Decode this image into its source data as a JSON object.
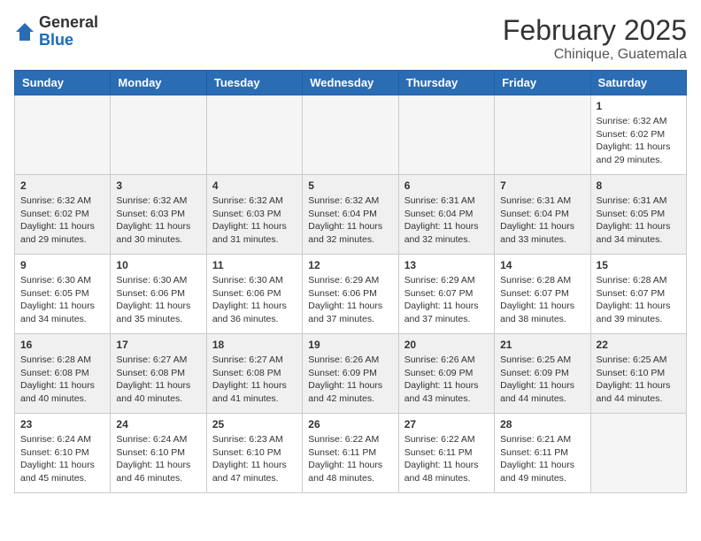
{
  "header": {
    "logo": {
      "general": "General",
      "blue": "Blue"
    },
    "title": "February 2025",
    "location": "Chinique, Guatemala"
  },
  "days_of_week": [
    "Sunday",
    "Monday",
    "Tuesday",
    "Wednesday",
    "Thursday",
    "Friday",
    "Saturday"
  ],
  "weeks": [
    {
      "bg": "white",
      "days": [
        {
          "num": "",
          "info": ""
        },
        {
          "num": "",
          "info": ""
        },
        {
          "num": "",
          "info": ""
        },
        {
          "num": "",
          "info": ""
        },
        {
          "num": "",
          "info": ""
        },
        {
          "num": "",
          "info": ""
        },
        {
          "num": "1",
          "info": "Sunrise: 6:32 AM\nSunset: 6:02 PM\nDaylight: 11 hours and 29 minutes."
        }
      ]
    },
    {
      "bg": "gray",
      "days": [
        {
          "num": "2",
          "info": "Sunrise: 6:32 AM\nSunset: 6:02 PM\nDaylight: 11 hours and 29 minutes."
        },
        {
          "num": "3",
          "info": "Sunrise: 6:32 AM\nSunset: 6:03 PM\nDaylight: 11 hours and 30 minutes."
        },
        {
          "num": "4",
          "info": "Sunrise: 6:32 AM\nSunset: 6:03 PM\nDaylight: 11 hours and 31 minutes."
        },
        {
          "num": "5",
          "info": "Sunrise: 6:32 AM\nSunset: 6:04 PM\nDaylight: 11 hours and 32 minutes."
        },
        {
          "num": "6",
          "info": "Sunrise: 6:31 AM\nSunset: 6:04 PM\nDaylight: 11 hours and 32 minutes."
        },
        {
          "num": "7",
          "info": "Sunrise: 6:31 AM\nSunset: 6:04 PM\nDaylight: 11 hours and 33 minutes."
        },
        {
          "num": "8",
          "info": "Sunrise: 6:31 AM\nSunset: 6:05 PM\nDaylight: 11 hours and 34 minutes."
        }
      ]
    },
    {
      "bg": "white",
      "days": [
        {
          "num": "9",
          "info": "Sunrise: 6:30 AM\nSunset: 6:05 PM\nDaylight: 11 hours and 34 minutes."
        },
        {
          "num": "10",
          "info": "Sunrise: 6:30 AM\nSunset: 6:06 PM\nDaylight: 11 hours and 35 minutes."
        },
        {
          "num": "11",
          "info": "Sunrise: 6:30 AM\nSunset: 6:06 PM\nDaylight: 11 hours and 36 minutes."
        },
        {
          "num": "12",
          "info": "Sunrise: 6:29 AM\nSunset: 6:06 PM\nDaylight: 11 hours and 37 minutes."
        },
        {
          "num": "13",
          "info": "Sunrise: 6:29 AM\nSunset: 6:07 PM\nDaylight: 11 hours and 37 minutes."
        },
        {
          "num": "14",
          "info": "Sunrise: 6:28 AM\nSunset: 6:07 PM\nDaylight: 11 hours and 38 minutes."
        },
        {
          "num": "15",
          "info": "Sunrise: 6:28 AM\nSunset: 6:07 PM\nDaylight: 11 hours and 39 minutes."
        }
      ]
    },
    {
      "bg": "gray",
      "days": [
        {
          "num": "16",
          "info": "Sunrise: 6:28 AM\nSunset: 6:08 PM\nDaylight: 11 hours and 40 minutes."
        },
        {
          "num": "17",
          "info": "Sunrise: 6:27 AM\nSunset: 6:08 PM\nDaylight: 11 hours and 40 minutes."
        },
        {
          "num": "18",
          "info": "Sunrise: 6:27 AM\nSunset: 6:08 PM\nDaylight: 11 hours and 41 minutes."
        },
        {
          "num": "19",
          "info": "Sunrise: 6:26 AM\nSunset: 6:09 PM\nDaylight: 11 hours and 42 minutes."
        },
        {
          "num": "20",
          "info": "Sunrise: 6:26 AM\nSunset: 6:09 PM\nDaylight: 11 hours and 43 minutes."
        },
        {
          "num": "21",
          "info": "Sunrise: 6:25 AM\nSunset: 6:09 PM\nDaylight: 11 hours and 44 minutes."
        },
        {
          "num": "22",
          "info": "Sunrise: 6:25 AM\nSunset: 6:10 PM\nDaylight: 11 hours and 44 minutes."
        }
      ]
    },
    {
      "bg": "white",
      "days": [
        {
          "num": "23",
          "info": "Sunrise: 6:24 AM\nSunset: 6:10 PM\nDaylight: 11 hours and 45 minutes."
        },
        {
          "num": "24",
          "info": "Sunrise: 6:24 AM\nSunset: 6:10 PM\nDaylight: 11 hours and 46 minutes."
        },
        {
          "num": "25",
          "info": "Sunrise: 6:23 AM\nSunset: 6:10 PM\nDaylight: 11 hours and 47 minutes."
        },
        {
          "num": "26",
          "info": "Sunrise: 6:22 AM\nSunset: 6:11 PM\nDaylight: 11 hours and 48 minutes."
        },
        {
          "num": "27",
          "info": "Sunrise: 6:22 AM\nSunset: 6:11 PM\nDaylight: 11 hours and 48 minutes."
        },
        {
          "num": "28",
          "info": "Sunrise: 6:21 AM\nSunset: 6:11 PM\nDaylight: 11 hours and 49 minutes."
        },
        {
          "num": "",
          "info": ""
        }
      ]
    }
  ]
}
